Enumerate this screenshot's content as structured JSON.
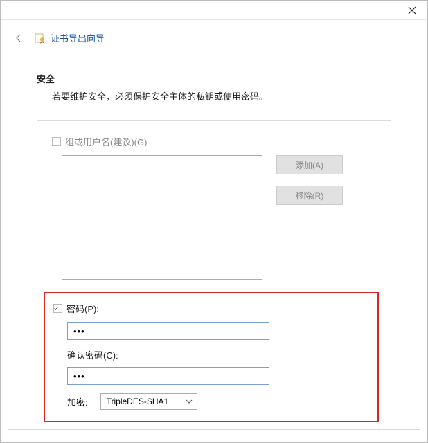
{
  "wizard": {
    "title": "证书导出向导"
  },
  "security": {
    "heading": "安全",
    "description": "若要维护安全，必须保护安全主体的私钥或使用密码。"
  },
  "group": {
    "checkbox_label": "组或用户名(建议)(G)"
  },
  "buttons": {
    "add": "添加(A)",
    "remove": "移除(R)"
  },
  "password": {
    "checkbox_label": "密码(P):",
    "value": "•••",
    "confirm_label": "确认密码(C):",
    "confirm_value": "•••"
  },
  "encryption": {
    "label": "加密:",
    "selected": "TripleDES-SHA1"
  }
}
